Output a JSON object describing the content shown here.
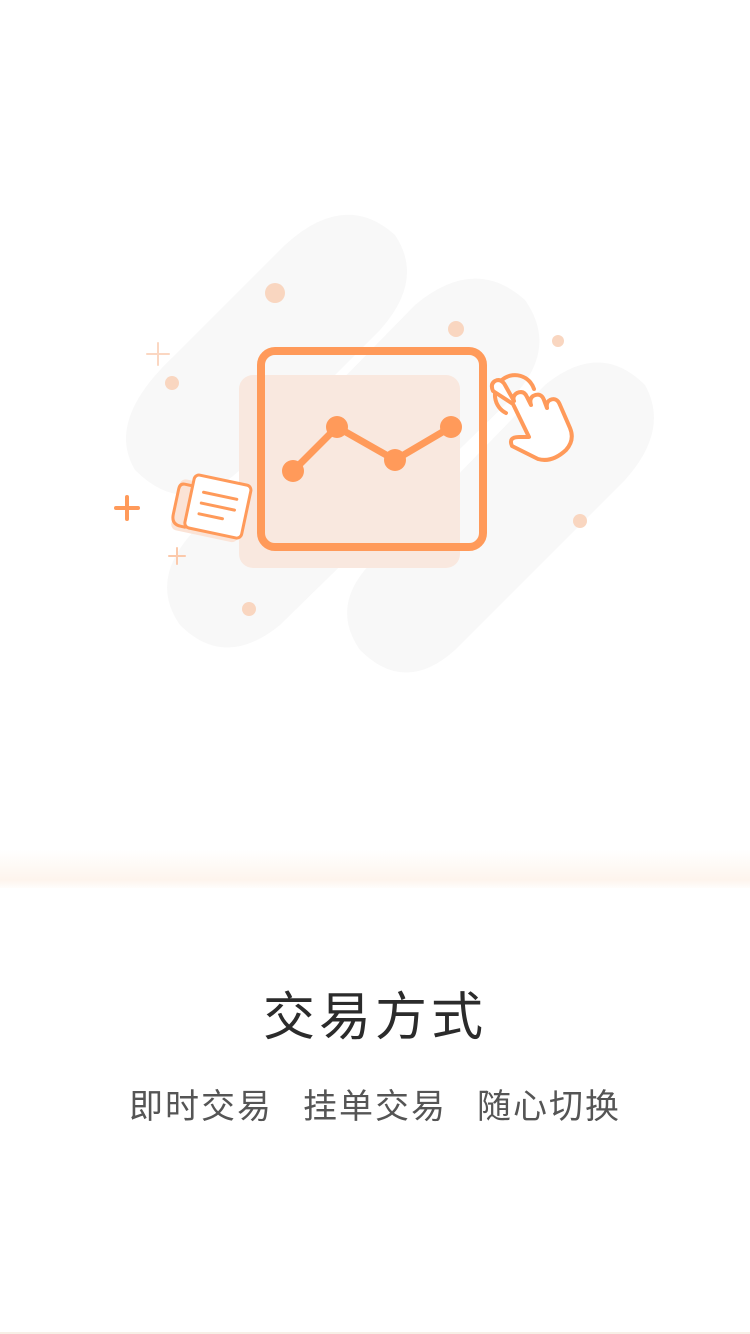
{
  "onboarding": {
    "title": "交易方式",
    "features": [
      "即时交易",
      "挂单交易",
      "随心切换"
    ]
  },
  "theme": {
    "accent": "#FF9A5A",
    "accent_light": "#F9E8DF",
    "background_shape": "#F8F8F8",
    "title_color": "#2B2B2B",
    "subtitle_color": "#555555"
  },
  "illustration": {
    "icons": [
      "line-chart-icon",
      "newspaper-icon",
      "tap-hand-icon",
      "plus-icon",
      "sparkle-dot-icon"
    ]
  }
}
